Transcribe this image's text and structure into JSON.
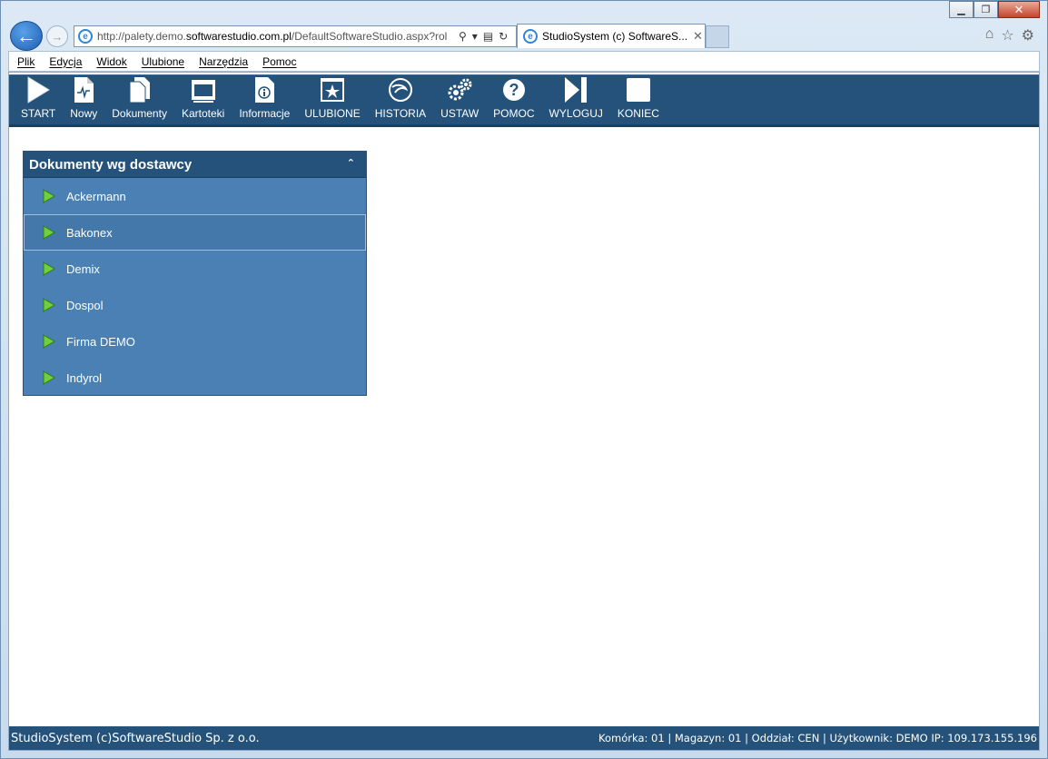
{
  "browser": {
    "url_prefix": "http://palety.demo.",
    "url_domain": "softwarestudio.com.pl",
    "url_suffix": "/DefaultSoftwareStudio.aspx?rol",
    "tab_title": "StudioSystem (c) SoftwareS...",
    "menu": [
      "Plik",
      "Edycja",
      "Widok",
      "Ulubione",
      "Narzędzia",
      "Pomoc"
    ]
  },
  "toolbar": {
    "items": [
      {
        "label": "START",
        "icon": "play-icon"
      },
      {
        "label": "Nowy",
        "icon": "new-document-icon"
      },
      {
        "label": "Dokumenty",
        "icon": "documents-icon"
      },
      {
        "label": "Kartoteki",
        "icon": "cards-icon"
      },
      {
        "label": "Informacje",
        "icon": "info-icon"
      },
      {
        "label": "ULUBIONE",
        "icon": "star-icon"
      },
      {
        "label": "HISTORIA",
        "icon": "history-icon"
      },
      {
        "label": "USTAW",
        "icon": "gears-icon"
      },
      {
        "label": "POMOC",
        "icon": "help-icon"
      },
      {
        "label": "WYLOGUJ",
        "icon": "logout-icon"
      },
      {
        "label": "KONIEC",
        "icon": "stop-icon"
      }
    ]
  },
  "panel": {
    "title": "Dokumenty wg dostawcy",
    "items": [
      "Ackermann",
      "Bakonex",
      "Demix",
      "Dospol",
      "Firma DEMO",
      "Indyrol"
    ]
  },
  "status": {
    "left": "StudioSystem (c)SoftwareStudio Sp. z o.o.",
    "right": "Komórka: 01 | Magazyn: 01 | Oddział: CEN | Użytkownik: DEMO IP: 109.173.155.196"
  }
}
